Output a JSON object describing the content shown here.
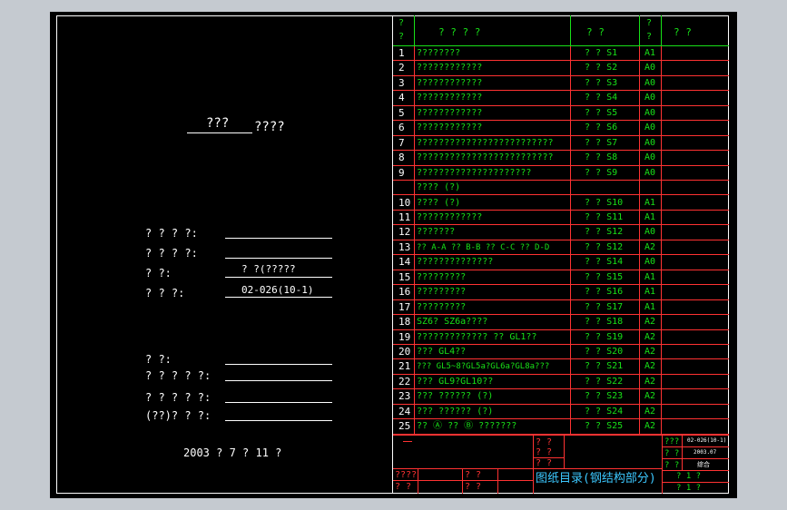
{
  "cover": {
    "title_prefix": "???",
    "title_suffix": "????",
    "info_rows": [
      {
        "label": "? ? ? ?:",
        "value": ""
      },
      {
        "label": "? ? ? ?:",
        "value": ""
      },
      {
        "label": "?         ?:",
        "value": "? ?(?????"
      },
      {
        "label": "?     ?     ?:",
        "value": "02-026(10-1)"
      }
    ],
    "sign_rows": [
      {
        "label": "?              ?:"
      },
      {
        "label": "? ? ? ? ?:"
      },
      {
        "label": "? ? ? ? ?:"
      },
      {
        "label": "(??)? ? ?:"
      }
    ],
    "date": "2003 ?  7 ?  11 ?"
  },
  "table": {
    "header": {
      "seq_a": "?",
      "seq_b": "?",
      "name": "?    ?    ?    ?",
      "drawing_no": "?   ?",
      "size_a": "?",
      "size_b": "?",
      "remark": "?      ?"
    },
    "rows": [
      {
        "n": "1",
        "name": "????????",
        "code": "? ? S1",
        "size": "A1"
      },
      {
        "n": "2",
        "name": "????????????",
        "code": "? ? S2",
        "size": "A0"
      },
      {
        "n": "3",
        "name": "????????????",
        "code": "? ? S3",
        "size": "A0"
      },
      {
        "n": "4",
        "name": "????????????",
        "code": "? ? S4",
        "size": "A0"
      },
      {
        "n": "5",
        "name": "????????????",
        "code": "? ? S5",
        "size": "A0"
      },
      {
        "n": "6",
        "name": "????????????",
        "code": "? ? S6",
        "size": "A0"
      },
      {
        "n": "7",
        "name": "?????????????????????????",
        "code": "? ? S7",
        "size": "A0"
      },
      {
        "n": "8",
        "name": "?????????????????????????",
        "code": "? ? S8",
        "size": "A0"
      },
      {
        "n": "9",
        "name": "?????????????????????",
        "code": "? ? S9",
        "size": "A0"
      },
      {
        "n": "",
        "name": "???? (?)",
        "code": "",
        "size": ""
      },
      {
        "n": "10",
        "name": "???? (?)",
        "code": "? ? S10",
        "size": "A1"
      },
      {
        "n": "11",
        "name": "????????????",
        "code": "? ? S11",
        "size": "A1"
      },
      {
        "n": "12",
        "name": "???????",
        "code": "? ? S12",
        "size": "A0"
      },
      {
        "n": "13",
        "name": "?? A-A   ?? B-B  ?? C-C   ?? D-D",
        "code": "? ? S12",
        "size": "A2"
      },
      {
        "n": "14",
        "name": "??????????????",
        "code": "? ? S14",
        "size": "A0"
      },
      {
        "n": "15",
        "name": "?????????",
        "code": "? ? S15",
        "size": "A1"
      },
      {
        "n": "16",
        "name": "?????????",
        "code": "? ? S16",
        "size": "A1"
      },
      {
        "n": "17",
        "name": "?????????",
        "code": "? ? S17",
        "size": "A1"
      },
      {
        "n": "18",
        "name": "SZ6? SZ6a????",
        "code": "? ? S18",
        "size": "A2"
      },
      {
        "n": "19",
        "name": "?????????????   ?? GL1??",
        "code": "? ? S19",
        "size": "A2"
      },
      {
        "n": "20",
        "name": "??? GL4??",
        "code": "? ? S20",
        "size": "A2"
      },
      {
        "n": "21",
        "name": "??? GL5~8?GL5a?GL6a?GL8a???",
        "code": "? ? S21",
        "size": "A2"
      },
      {
        "n": "22",
        "name": "??? GL9?GL10??",
        "code": "? ? S22",
        "size": "A2"
      },
      {
        "n": "23",
        "name": "??? ?????? (?)",
        "code": "? ? S23",
        "size": "A2"
      },
      {
        "n": "24",
        "name": "??? ?????? (?)",
        "code": "? ? S24",
        "size": "A2"
      },
      {
        "n": "25",
        "name": "??   Ⓐ   ??   Ⓑ    ???????",
        "code": "? ? S25",
        "size": "A2"
      }
    ]
  },
  "title_block": {
    "left_top": "????",
    "left_bottom": "?   ?",
    "mid_a": "?   ?",
    "mid_b": "?   ?",
    "small_q1": "?   ?",
    "small_q2": "?   ?",
    "small_q3": "?   ?",
    "drawing_title": "图纸目录(钢结构部分)",
    "r_label1": "???",
    "r_label2": "?  ?",
    "r_label3": "?  ?",
    "r_val1": "02-026(10-1)",
    "r_val2": "2003.07",
    "r_val3": "综合",
    "sheet1": "?   1   ?",
    "sheet2": "?   1   ?"
  }
}
